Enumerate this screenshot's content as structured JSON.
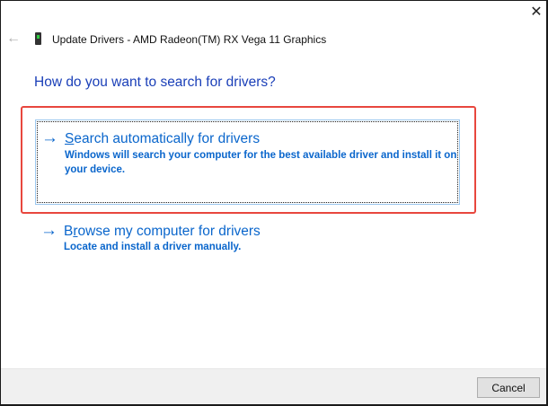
{
  "window": {
    "title": "Update Drivers - AMD Radeon(TM) RX Vega 11 Graphics"
  },
  "heading": "How do you want to search for drivers?",
  "options": [
    {
      "mnemonic": "S",
      "label_rest": "earch automatically for drivers",
      "description": "Windows will search your computer for the best available driver and install it on your device.",
      "selected": true
    },
    {
      "mnemonic_pre": "B",
      "mnemonic": "r",
      "label_rest": "owse my computer for drivers",
      "description": "Locate and install a driver manually.",
      "selected": false
    }
  ],
  "footer": {
    "cancel_label": "Cancel"
  },
  "colors": {
    "link": "#0a66cc",
    "highlight": "#e8473e",
    "heading": "#1a3fb8"
  },
  "icons": {
    "close": "close-icon",
    "back": "back-arrow-icon",
    "device": "display-adapter-icon",
    "option": "arrow-right-icon"
  }
}
